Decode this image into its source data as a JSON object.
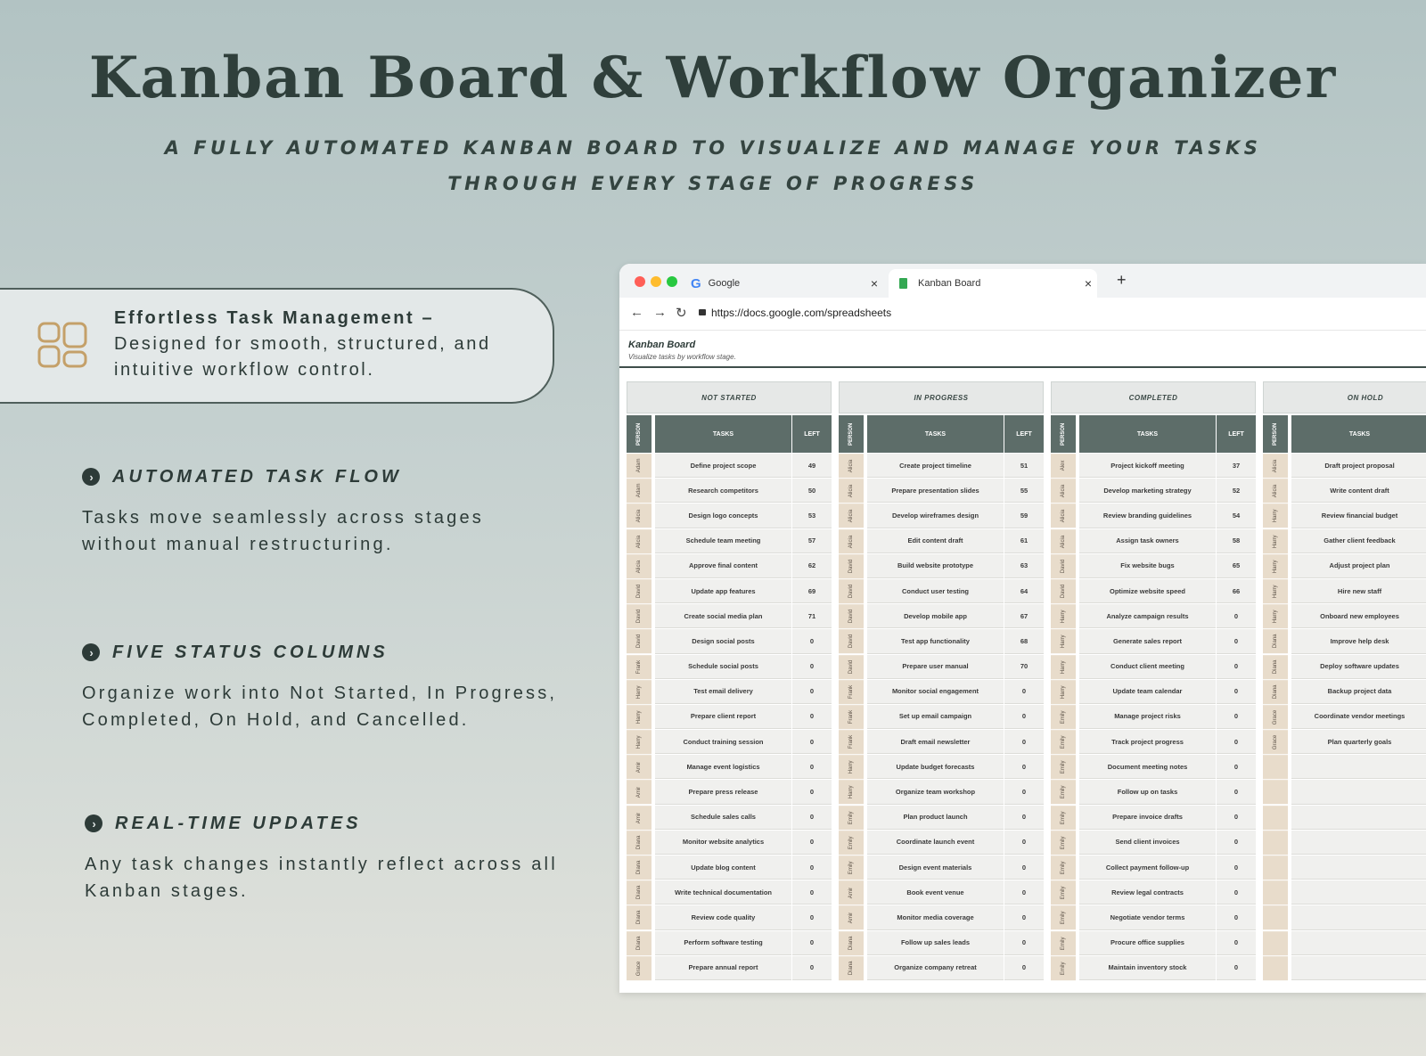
{
  "header": {
    "title": "Kanban Board & Workflow Organizer",
    "subtitle_line1": "A FULLY AUTOMATED KANBAN BOARD TO VISUALIZE AND MANAGE YOUR TASKS",
    "subtitle_line2": "THROUGH EVERY STAGE OF PROGRESS"
  },
  "highlight": {
    "icon": "layout-grid-icon",
    "heading": "Effortless Task Management –",
    "body": "Designed for smooth, structured, and intuitive workflow control."
  },
  "features": [
    {
      "title": "AUTOMATED TASK FLOW",
      "body": "Tasks move seamlessly across stages without manual restructuring."
    },
    {
      "title": "FIVE STATUS COLUMNS",
      "body": "Organize work into Not Started, In Progress, Completed, On Hold, and Cancelled."
    },
    {
      "title": "REAL-TIME UPDATES",
      "body": "Any task changes instantly reflect across all Kanban stages."
    }
  ],
  "browser": {
    "tabs": [
      {
        "label": "Google",
        "close": "×"
      },
      {
        "label": "Kanban Board",
        "close": "×"
      }
    ],
    "new_tab": "+",
    "url": "https://docs.google.com/spreadsheets"
  },
  "sheet": {
    "title": "Kanban Board",
    "subtitle": "Visualize tasks by workflow stage.",
    "headers": {
      "person": "PERSON",
      "tasks": "TASKS",
      "left": "LEFT"
    },
    "columns": [
      {
        "title": "NOT STARTED",
        "rows": [
          [
            "Adam",
            "Define project scope",
            "49"
          ],
          [
            "Adam",
            "Research competitors",
            "50"
          ],
          [
            "Alicia",
            "Design logo concepts",
            "53"
          ],
          [
            "Alicia",
            "Schedule team meeting",
            "57"
          ],
          [
            "Alicia",
            "Approve final content",
            "62"
          ],
          [
            "David",
            "Update app features",
            "69"
          ],
          [
            "David",
            "Create social media plan",
            "71"
          ],
          [
            "David",
            "Design social posts",
            "0"
          ],
          [
            "Frank",
            "Schedule social posts",
            "0"
          ],
          [
            "Harry",
            "Test email delivery",
            "0"
          ],
          [
            "Harry",
            "Prepare client report",
            "0"
          ],
          [
            "Harry",
            "Conduct training session",
            "0"
          ],
          [
            "Amir",
            "Manage event logistics",
            "0"
          ],
          [
            "Amir",
            "Prepare press release",
            "0"
          ],
          [
            "Amir",
            "Schedule sales calls",
            "0"
          ],
          [
            "Diana",
            "Monitor website analytics",
            "0"
          ],
          [
            "Diana",
            "Update blog content",
            "0"
          ],
          [
            "Diana",
            "Write technical documentation",
            "0"
          ],
          [
            "Diana",
            "Review code quality",
            "0"
          ],
          [
            "Diana",
            "Perform software testing",
            "0"
          ],
          [
            "Grace",
            "Prepare annual report",
            "0"
          ]
        ]
      },
      {
        "title": "IN PROGRESS",
        "rows": [
          [
            "Alicia",
            "Create project timeline",
            "51"
          ],
          [
            "Alicia",
            "Prepare presentation slides",
            "55"
          ],
          [
            "Alicia",
            "Develop wireframes design",
            "59"
          ],
          [
            "Alicia",
            "Edit content draft",
            "61"
          ],
          [
            "David",
            "Build website prototype",
            "63"
          ],
          [
            "David",
            "Conduct user testing",
            "64"
          ],
          [
            "David",
            "Develop mobile app",
            "67"
          ],
          [
            "David",
            "Test app functionality",
            "68"
          ],
          [
            "David",
            "Prepare user manual",
            "70"
          ],
          [
            "Frank",
            "Monitor social engagement",
            "0"
          ],
          [
            "Frank",
            "Set up email campaign",
            "0"
          ],
          [
            "Frank",
            "Draft email newsletter",
            "0"
          ],
          [
            "Harry",
            "Update budget forecasts",
            "0"
          ],
          [
            "Harry",
            "Organize team workshop",
            "0"
          ],
          [
            "Emily",
            "Plan product launch",
            "0"
          ],
          [
            "Emily",
            "Coordinate launch event",
            "0"
          ],
          [
            "Emily",
            "Design event materials",
            "0"
          ],
          [
            "Amir",
            "Book event venue",
            "0"
          ],
          [
            "Amir",
            "Monitor media coverage",
            "0"
          ],
          [
            "Diana",
            "Follow up sales leads",
            "0"
          ],
          [
            "Diana",
            "Organize company retreat",
            "0"
          ]
        ]
      },
      {
        "title": "COMPLETED",
        "rows": [
          [
            "Alex",
            "Project kickoff meeting",
            "37"
          ],
          [
            "Alicia",
            "Develop marketing strategy",
            "52"
          ],
          [
            "Alicia",
            "Review branding guidelines",
            "54"
          ],
          [
            "Alicia",
            "Assign task owners",
            "58"
          ],
          [
            "David",
            "Fix website bugs",
            "65"
          ],
          [
            "David",
            "Optimize website speed",
            "66"
          ],
          [
            "Harry",
            "Analyze campaign results",
            "0"
          ],
          [
            "Harry",
            "Generate sales report",
            "0"
          ],
          [
            "Harry",
            "Conduct client meeting",
            "0"
          ],
          [
            "Harry",
            "Update team calendar",
            "0"
          ],
          [
            "Emily",
            "Manage project risks",
            "0"
          ],
          [
            "Emily",
            "Track project progress",
            "0"
          ],
          [
            "Emily",
            "Document meeting notes",
            "0"
          ],
          [
            "Emily",
            "Follow up on tasks",
            "0"
          ],
          [
            "Emily",
            "Prepare invoice drafts",
            "0"
          ],
          [
            "Emily",
            "Send client invoices",
            "0"
          ],
          [
            "Emily",
            "Collect payment follow-up",
            "0"
          ],
          [
            "Emily",
            "Review legal contracts",
            "0"
          ],
          [
            "Emily",
            "Negotiate vendor terms",
            "0"
          ],
          [
            "Emily",
            "Procure office supplies",
            "0"
          ],
          [
            "Emily",
            "Maintain inventory stock",
            "0"
          ]
        ]
      },
      {
        "title": "ON HOLD",
        "rows": [
          [
            "Alicia",
            "Draft project proposal",
            ""
          ],
          [
            "Alicia",
            "Write content draft",
            ""
          ],
          [
            "Harry",
            "Review financial budget",
            ""
          ],
          [
            "Harry",
            "Gather client feedback",
            ""
          ],
          [
            "Harry",
            "Adjust project plan",
            ""
          ],
          [
            "Harry",
            "Hire new staff",
            ""
          ],
          [
            "Harry",
            "Onboard new employees",
            ""
          ],
          [
            "Diana",
            "Improve help desk",
            ""
          ],
          [
            "Diana",
            "Deploy software updates",
            ""
          ],
          [
            "Diana",
            "Backup project data",
            ""
          ],
          [
            "Grace",
            "Coordinate vendor meetings",
            ""
          ],
          [
            "Grace",
            "Plan quarterly goals",
            ""
          ],
          [
            "",
            "",
            ""
          ],
          [
            "",
            "",
            ""
          ],
          [
            "",
            "",
            ""
          ],
          [
            "",
            "",
            ""
          ],
          [
            "",
            "",
            ""
          ],
          [
            "",
            "",
            ""
          ],
          [
            "",
            "",
            ""
          ],
          [
            "",
            "",
            ""
          ],
          [
            "",
            "",
            ""
          ]
        ]
      }
    ]
  },
  "colors": {
    "accent_dark": "#2f3f3b",
    "header_cell": "#5d6d69",
    "person_cell": "#e8dccb",
    "icon_gold": "#c4a069"
  }
}
